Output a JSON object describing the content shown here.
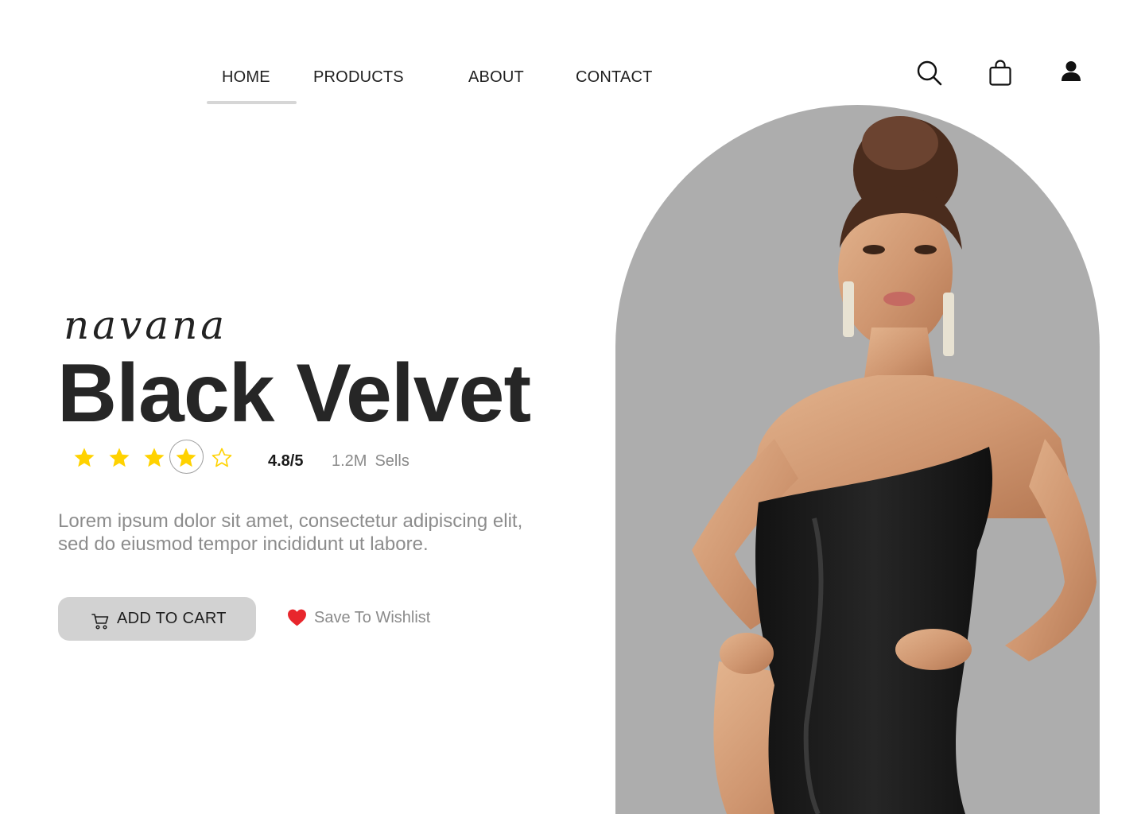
{
  "nav": {
    "items": [
      {
        "label": "HOME",
        "active": true
      },
      {
        "label": "PRODUCTS"
      },
      {
        "label": "ABOUT"
      },
      {
        "label": "CONTACT"
      }
    ],
    "icons": [
      "search-icon",
      "shopping-bag-icon",
      "user-icon"
    ]
  },
  "product": {
    "brand": "navana",
    "title": "Black Velvet",
    "rating_text": "4.8/5",
    "stars": {
      "filled": 4,
      "total": 5
    },
    "sold_count": "1.2M",
    "sold_label": "Sells",
    "description_line1": "Lorem ipsum dolor sit amet, consectetur adipiscing elit,",
    "description_line2": "sed do eiusmod tempor incididunt ut labore."
  },
  "actions": {
    "cart_label": "ADD TO CART",
    "wishlist_label": "Save To Wishlist"
  },
  "colors": {
    "star": "#FFD200",
    "heart": "#E8262C",
    "button_bg": "#D2D2D2",
    "arch_bg": "#ADADAD",
    "title_text": "#262626",
    "muted_text": "#8C8C8C"
  }
}
